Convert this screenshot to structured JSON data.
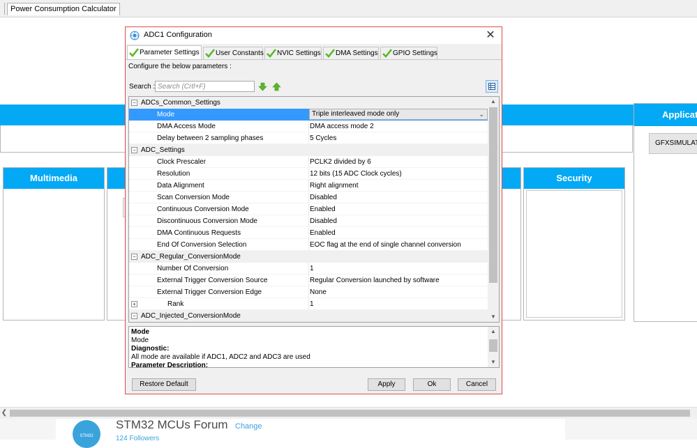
{
  "app": {
    "tab_label": "Power Consumption Calculator",
    "categories": [
      {
        "label": "Multimedia"
      },
      {
        "label": "Security"
      }
    ],
    "right_panel": {
      "label": "Applicati",
      "button_label": "GFXSIMULATO"
    },
    "footer": {
      "forum_title": "STM32 MCUs Forum",
      "change_label": "Change",
      "followers": "124 Followers",
      "logo_text": "STM32"
    }
  },
  "dialog": {
    "title": "ADC1 Configuration",
    "close_symbol": "✕",
    "tabs": [
      {
        "label": "Parameter Settings",
        "active": true
      },
      {
        "label": "User Constants",
        "active": false
      },
      {
        "label": "NVIC Settings",
        "active": false
      },
      {
        "label": "DMA Settings",
        "active": false
      },
      {
        "label": "GPIO Settings",
        "active": false
      }
    ],
    "configure_label": "Configure the below parameters :",
    "search": {
      "label": "Search :",
      "placeholder": "Search (Crtl+F)"
    },
    "groups": [
      {
        "name": "ADCs_Common_Settings",
        "toggle": "−",
        "params": [
          {
            "name": "Mode",
            "value": "Triple interleaved mode only",
            "selected": true,
            "dropdown": true
          },
          {
            "name": "DMA Access Mode",
            "value": "DMA access mode 2"
          },
          {
            "name": "Delay between 2 sampling phases",
            "value": "5 Cycles"
          }
        ]
      },
      {
        "name": "ADC_Settings",
        "toggle": "−",
        "params": [
          {
            "name": "Clock Prescaler",
            "value": "PCLK2 divided by 6"
          },
          {
            "name": "Resolution",
            "value": "12 bits (15 ADC Clock cycles)"
          },
          {
            "name": "Data Alignment",
            "value": "Right alignment"
          },
          {
            "name": "Scan Conversion Mode",
            "value": "Disabled"
          },
          {
            "name": "Continuous Conversion Mode",
            "value": "Enabled"
          },
          {
            "name": "Discontinuous Conversion Mode",
            "value": "Disabled"
          },
          {
            "name": "DMA Continuous Requests",
            "value": "Enabled"
          },
          {
            "name": "End Of Conversion Selection",
            "value": "EOC flag at the end of single channel conversion"
          }
        ]
      },
      {
        "name": "ADC_Regular_ConversionMode",
        "toggle": "−",
        "params": [
          {
            "name": "Number Of Conversion",
            "value": "1"
          },
          {
            "name": "External Trigger Conversion Source",
            "value": "Regular Conversion launched by software"
          },
          {
            "name": "External Trigger Conversion Edge",
            "value": "None"
          },
          {
            "name": "Rank",
            "value": "1",
            "toggle": "+",
            "sub": true
          }
        ]
      },
      {
        "name": "ADC_Injected_ConversionMode",
        "toggle": "−",
        "params": []
      }
    ],
    "description": {
      "param_title": "Mode",
      "param_text": "Mode",
      "diagnostic_title": "Diagnostic:",
      "diagnostic_text": "All mode are available if ADC1, ADC2 and ADC3 are used",
      "next_title": "Parameter Description:"
    },
    "buttons": {
      "restore": "Restore Default",
      "apply": "Apply",
      "ok": "Ok",
      "cancel": "Cancel"
    },
    "colors": {
      "accent": "#03a9f4",
      "selection": "#3399ff",
      "check": "#5cb82b",
      "dialog_border": "#e04a4a"
    }
  }
}
